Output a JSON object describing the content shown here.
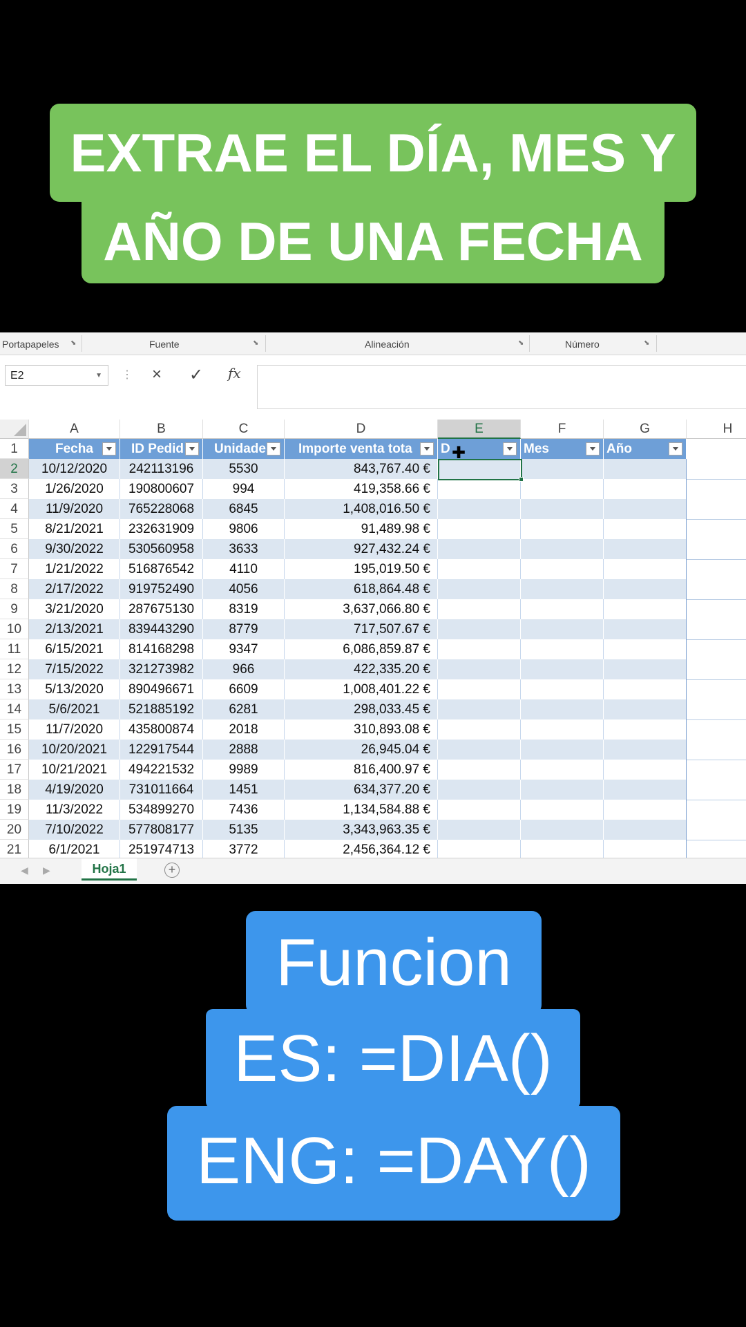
{
  "title": {
    "line1": "EXTRAE EL DÍA, MES Y",
    "line2": "AÑO DE UNA FECHA"
  },
  "function_caption": {
    "line1": "Funcion",
    "line2": "ES: =DIA()",
    "line3": "ENG: =DAY()"
  },
  "ribbon": {
    "groups": [
      "Portapapeles",
      "Fuente",
      "Alineación",
      "Número"
    ]
  },
  "formula_bar": {
    "name_box": "E2",
    "cancel_icon": "×",
    "enter_icon": "✓",
    "fx_label": "fx",
    "content": ""
  },
  "columns": [
    "A",
    "B",
    "C",
    "D",
    "E",
    "F",
    "G",
    "H"
  ],
  "table_headers": [
    "Fecha",
    "ID Pedid",
    "Unidade",
    "Importe venta tota",
    "D",
    "Mes",
    "Año"
  ],
  "rows": [
    {
      "n": "2",
      "fecha": "10/12/2020",
      "id": "242113196",
      "unidades": "5530",
      "importe": "843,767.40 €"
    },
    {
      "n": "3",
      "fecha": "1/26/2020",
      "id": "190800607",
      "unidades": "994",
      "importe": "419,358.66 €"
    },
    {
      "n": "4",
      "fecha": "11/9/2020",
      "id": "765228068",
      "unidades": "6845",
      "importe": "1,408,016.50 €"
    },
    {
      "n": "5",
      "fecha": "8/21/2021",
      "id": "232631909",
      "unidades": "9806",
      "importe": "91,489.98 €"
    },
    {
      "n": "6",
      "fecha": "9/30/2022",
      "id": "530560958",
      "unidades": "3633",
      "importe": "927,432.24 €"
    },
    {
      "n": "7",
      "fecha": "1/21/2022",
      "id": "516876542",
      "unidades": "4110",
      "importe": "195,019.50 €"
    },
    {
      "n": "8",
      "fecha": "2/17/2022",
      "id": "919752490",
      "unidades": "4056",
      "importe": "618,864.48 €"
    },
    {
      "n": "9",
      "fecha": "3/21/2020",
      "id": "287675130",
      "unidades": "8319",
      "importe": "3,637,066.80 €"
    },
    {
      "n": "10",
      "fecha": "2/13/2021",
      "id": "839443290",
      "unidades": "8779",
      "importe": "717,507.67 €"
    },
    {
      "n": "11",
      "fecha": "6/15/2021",
      "id": "814168298",
      "unidades": "9347",
      "importe": "6,086,859.87 €"
    },
    {
      "n": "12",
      "fecha": "7/15/2022",
      "id": "321273982",
      "unidades": "966",
      "importe": "422,335.20 €"
    },
    {
      "n": "13",
      "fecha": "5/13/2020",
      "id": "890496671",
      "unidades": "6609",
      "importe": "1,008,401.22 €"
    },
    {
      "n": "14",
      "fecha": "5/6/2021",
      "id": "521885192",
      "unidades": "6281",
      "importe": "298,033.45 €"
    },
    {
      "n": "15",
      "fecha": "11/7/2020",
      "id": "435800874",
      "unidades": "2018",
      "importe": "310,893.08 €"
    },
    {
      "n": "16",
      "fecha": "10/20/2021",
      "id": "122917544",
      "unidades": "2888",
      "importe": "26,945.04 €"
    },
    {
      "n": "17",
      "fecha": "10/21/2021",
      "id": "494221532",
      "unidades": "9989",
      "importe": "816,400.97 €"
    },
    {
      "n": "18",
      "fecha": "4/19/2020",
      "id": "731011664",
      "unidades": "1451",
      "importe": "634,377.20 €"
    },
    {
      "n": "19",
      "fecha": "11/3/2022",
      "id": "534899270",
      "unidades": "7436",
      "importe": "1,134,584.88 €"
    },
    {
      "n": "20",
      "fecha": "7/10/2022",
      "id": "577808177",
      "unidades": "5135",
      "importe": "3,343,963.35 €"
    },
    {
      "n": "21",
      "fecha": "6/1/2021",
      "id": "251974713",
      "unidades": "3772",
      "importe": "2,456,364.12 €"
    }
  ],
  "sheet_tabs": {
    "active": "Hoja1",
    "add_icon": "+"
  },
  "colors": {
    "title_bg": "#78c35c",
    "caption_bg": "#3d96ec",
    "header_bg": "#6e9fd7",
    "band_bg": "#dce6f1",
    "excel_green": "#217346"
  }
}
